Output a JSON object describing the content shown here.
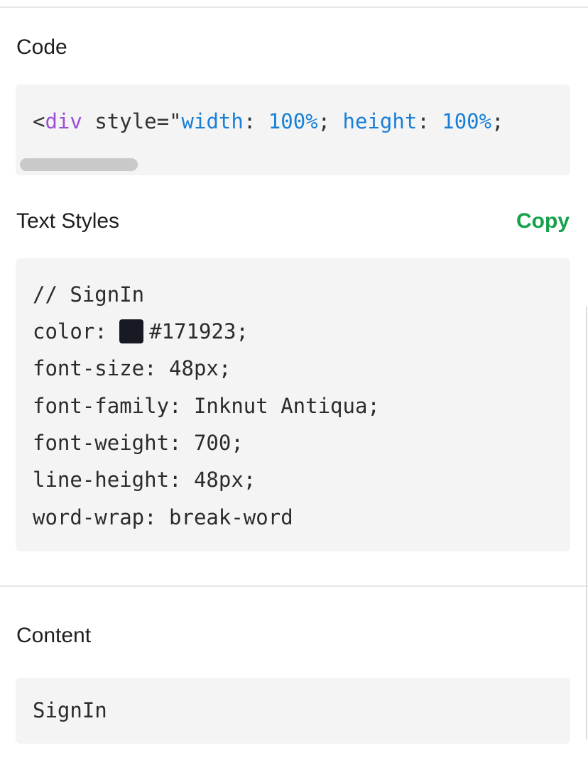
{
  "code_section": {
    "title": "Code",
    "snippet": {
      "open_bracket": "<",
      "tag": "div",
      "attr": " style=\"",
      "prop1": "width",
      "sep1": ": ",
      "val1": "100%",
      "semi1": "; ",
      "prop2": "height",
      "sep2": ": ",
      "val2": "100%",
      "semi2": ";"
    }
  },
  "text_styles_section": {
    "title": "Text Styles",
    "copy_label": "Copy",
    "comment": "// SignIn",
    "color_prefix": "color: ",
    "color_value": "#171923;",
    "swatch_color": "#171923",
    "lines": [
      "font-size: 48px;",
      "font-family: Inknut Antiqua;",
      "font-weight: 700;",
      "line-height: 48px;",
      "word-wrap: break-word"
    ]
  },
  "content_section": {
    "title": "Content",
    "value": "SignIn"
  },
  "colors": {
    "accent_green": "#14a14a",
    "code_bg": "#f4f4f5"
  }
}
